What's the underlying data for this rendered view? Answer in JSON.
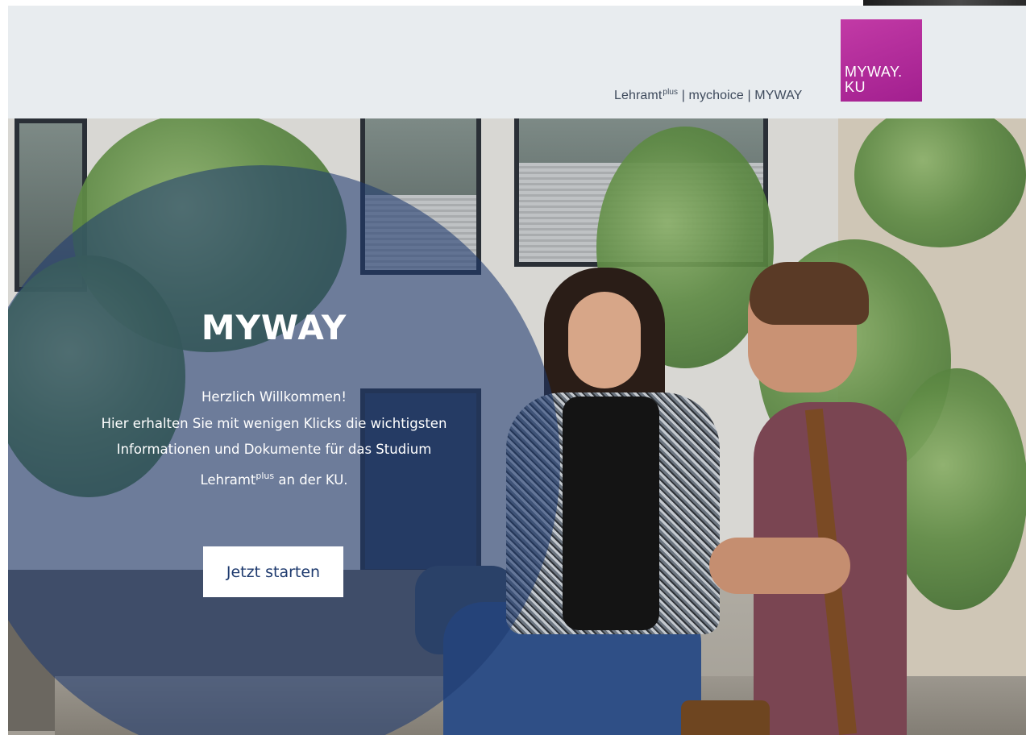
{
  "header": {
    "links": {
      "lehramt": "Lehramt",
      "lehramt_sup": "plus",
      "separator_1": " | ",
      "mychoice": "mychoice",
      "separator_2": " | ",
      "myway": "MYWAY"
    },
    "logo": {
      "line1": "MYWAY.",
      "line2": "KU",
      "color": "#b02a9a"
    }
  },
  "hero": {
    "title": "MYWAY",
    "greeting": "Herzlich Willkommen!",
    "line2": "Hier erhalten Sie mit wenigen Klicks die wichtigsten",
    "line3": "Informationen und Dokumente für das Studium",
    "line4_pre": "Lehramt",
    "line4_sup": "plus",
    "line4_post": " an der KU.",
    "cta_label": "Jetzt starten",
    "overlay_color": "#1f3b70",
    "cta_text_color": "#1e3a6e"
  }
}
